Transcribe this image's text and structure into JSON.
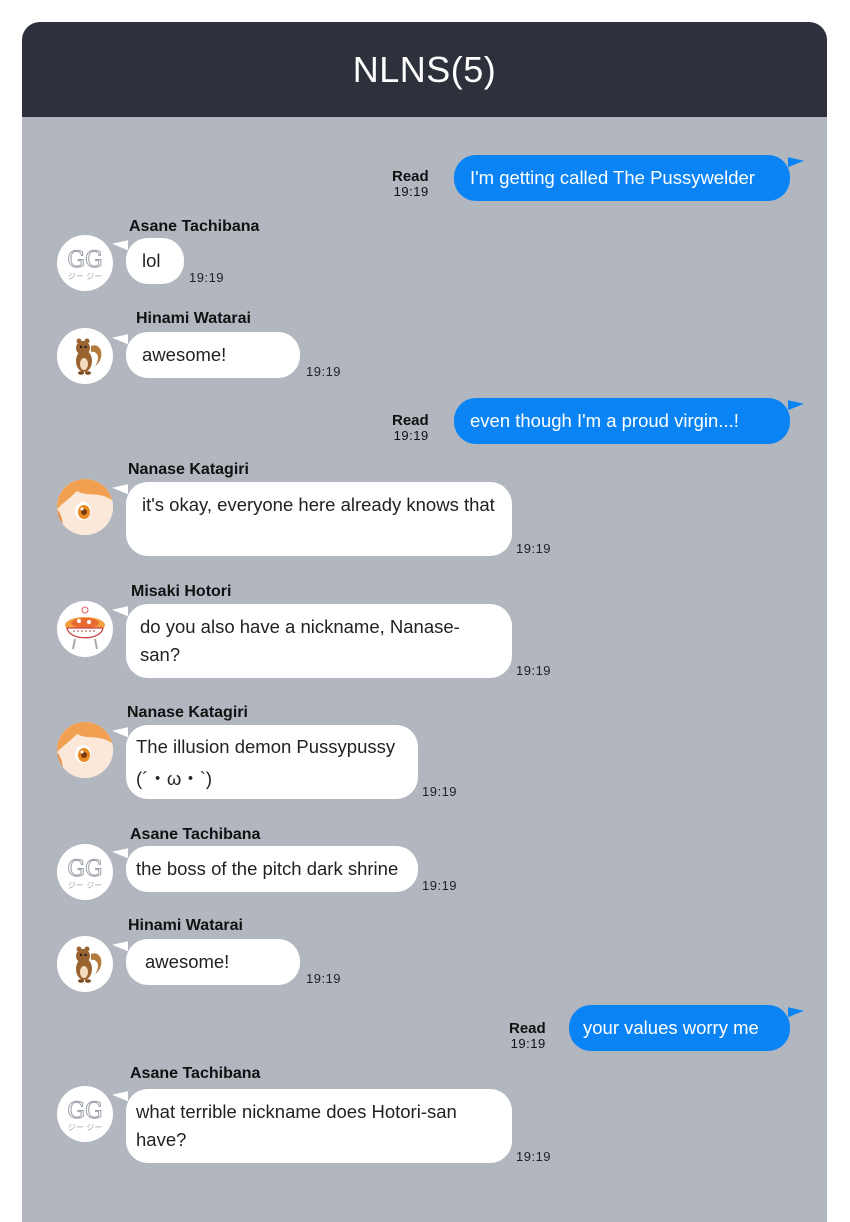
{
  "header": {
    "title": "NLNS(5)"
  },
  "messages": [
    {
      "type": "out",
      "text": "I'm getting called The Pussywelder",
      "status": "Read",
      "time": "19:19"
    },
    {
      "type": "in",
      "sender": "Asane Tachibana",
      "avatar": "gg-logo-avatar",
      "text": "lol",
      "time": "19:19"
    },
    {
      "type": "in",
      "sender": "Hinami Watarai",
      "avatar": "squirrel-avatar",
      "text": "awesome!",
      "time": "19:19"
    },
    {
      "type": "out",
      "text": "even though I'm a proud virgin...!",
      "status": "Read",
      "time": "19:19"
    },
    {
      "type": "in",
      "sender": "Nanase Katagiri",
      "avatar": "anime-girl-avatar",
      "text": "it's okay, everyone here already knows that",
      "time": "19:19"
    },
    {
      "type": "in",
      "sender": "Misaki Hotori",
      "avatar": "food-bowl-avatar",
      "text": "do you also have a nickname, Nanase-san?",
      "time": "19:19"
    },
    {
      "type": "in",
      "sender": "Nanase Katagiri",
      "avatar": "anime-girl-avatar",
      "text": "The illusion demon Pussypussy (´・ω・`)",
      "time": "19:19"
    },
    {
      "type": "in",
      "sender": "Asane Tachibana",
      "avatar": "gg-logo-avatar",
      "text": "the boss of the pitch dark shrine",
      "time": "19:19"
    },
    {
      "type": "in",
      "sender": "Hinami Watarai",
      "avatar": "squirrel-avatar",
      "text": "awesome!",
      "time": "19:19"
    },
    {
      "type": "out",
      "text": "your values worry me",
      "status": "Read",
      "time": "19:19"
    },
    {
      "type": "in",
      "sender": "Asane Tachibana",
      "avatar": "gg-logo-avatar",
      "text": "what terrible nickname does Hotori-san have?",
      "time": "19:19"
    }
  ],
  "colors": {
    "header_bg": "#2e313b",
    "chat_bg": "#b2b6bf",
    "outgoing_bubble": "#0a84f5",
    "incoming_bubble": "#ffffff"
  }
}
